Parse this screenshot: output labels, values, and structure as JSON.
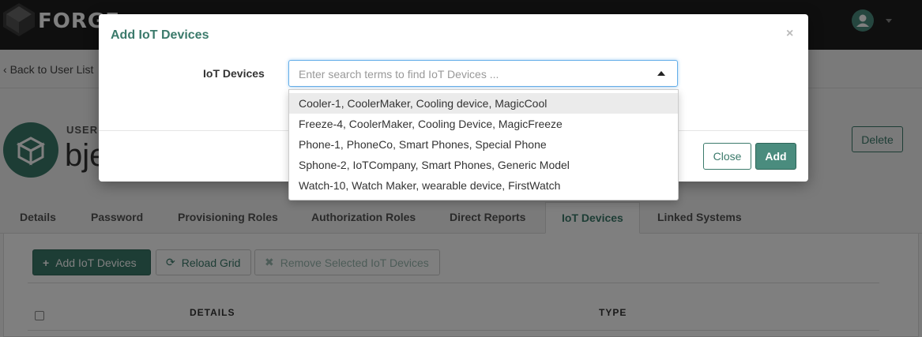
{
  "app": {
    "brand": "FORGE"
  },
  "page": {
    "back_link": "Back to User List",
    "user_type_label": "USER",
    "user_name": "bje",
    "delete_label": "Delete"
  },
  "tabs": [
    {
      "label": "Details"
    },
    {
      "label": "Password"
    },
    {
      "label": "Provisioning Roles"
    },
    {
      "label": "Authorization Roles"
    },
    {
      "label": "Direct Reports"
    },
    {
      "label": "IoT Devices"
    },
    {
      "label": "Linked Systems"
    }
  ],
  "toolbar": {
    "add_label": "Add IoT Devices",
    "reload_label": "Reload Grid",
    "remove_label": "Remove Selected IoT Devices"
  },
  "grid": {
    "columns": [
      "DETAILS",
      "TYPE"
    ]
  },
  "modal": {
    "title": "Add IoT Devices",
    "close_icon": "×",
    "field_label": "IoT Devices",
    "search_placeholder": "Enter search terms to find IoT Devices ...",
    "close_label": "Close",
    "add_label": "Add"
  },
  "dropdown": {
    "options": [
      "Cooler-1, CoolerMaker, Cooling device, MagicCool",
      "Freeze-4, CoolerMaker, Cooling Device, MagicFreeze",
      "Phone-1, PhoneCo, Smart Phones, Special Phone",
      "Sphone-2, IoTCompany, Smart Phones, Generic Model",
      "Watch-10, Watch Maker, wearable device, FirstWatch"
    ]
  },
  "colors": {
    "accent": "#3b7a6b",
    "topbar": "#1f1f1f"
  }
}
